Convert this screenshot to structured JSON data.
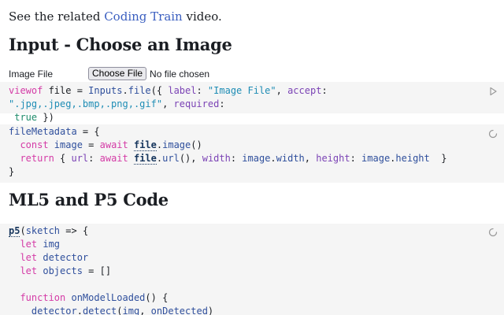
{
  "intro": {
    "prefix": "See the related ",
    "link_text": "Coding Train",
    "suffix": " video."
  },
  "section_input": {
    "title": "Input - Choose an Image"
  },
  "file_input": {
    "label": "Image File",
    "button_label": "Choose File",
    "status": "No file chosen"
  },
  "section_ml5": {
    "title": "ML5 and P5 Code"
  },
  "icons": {
    "run": "play-triangle-icon",
    "pending": "spinner-icon"
  },
  "code": {
    "viewof": {
      "t1": "viewof",
      "t2": " file = ",
      "t3": "Inputs",
      "t4": ".",
      "t5": "file",
      "t6": "({ ",
      "t7": "label",
      "t8": ": ",
      "t9": "\"Image File\"",
      "t10": ", ",
      "t11": "accept",
      "t12": ": ",
      "t13": "\".jpg,.jpeg,.bmp,.png,.gif\"",
      "t14": ", ",
      "t15": "required",
      "t16": ":",
      "t17": "true",
      "t18": " })"
    },
    "meta": {
      "l1_name": "fileMetadata",
      "l1_rest": " = {",
      "l2_kw": "  const",
      "l2_var": " image",
      "l2_eq": " = ",
      "l2_await": "await",
      "l2_sp": " ",
      "l2_ref": "file",
      "l2_dot": ".",
      "l2_fn": "image",
      "l2_end": "()",
      "l3_kw": "  return",
      "l3_open": " { ",
      "l3_url": "url",
      "l3_colon": ": ",
      "l3_await": "await",
      "l3_sp": " ",
      "l3_ref": "file",
      "l3_dot": ".",
      "l3_fn": "url",
      "l3_call": "(), ",
      "l3_width": "width",
      "l3_colon2": ": ",
      "l3_img1": "image",
      "l3_dot2": ".",
      "l3_w": "width",
      "l3_comma2": ", ",
      "l3_height": "height",
      "l3_colon3": ": ",
      "l3_img2": "image",
      "l3_dot3": ".",
      "l3_h": "height",
      "l3_close": "  }",
      "l4": "}"
    },
    "p5": {
      "l1_fn": "p5",
      "l1_open": "(",
      "l1_arg": "sketch",
      "l1_rest": " => {",
      "l2_kw": "  let",
      "l2_var": " img",
      "l3_kw": "  let",
      "l3_var": " detector",
      "l4_kw": "  let",
      "l4_var": " objects",
      "l4_rest": " = []",
      "l5": "",
      "l6_kw": "  function",
      "l6_fn": " onModelLoaded",
      "l6_rest": "() {",
      "l7_indent": "    ",
      "l7_obj": "detector",
      "l7_dot": ".",
      "l7_fn": "detect",
      "l7_open": "(",
      "l7_arg1": "img",
      "l7_comma": ", ",
      "l7_arg2": "onDetected",
      "l7_close": ")"
    }
  }
}
